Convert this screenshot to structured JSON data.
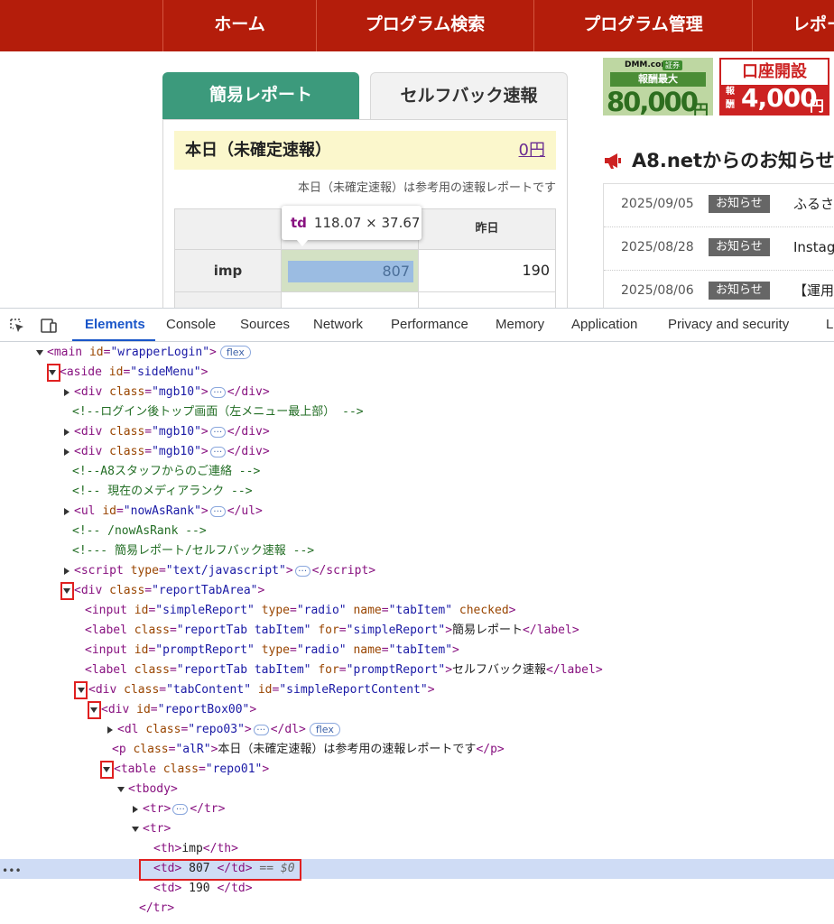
{
  "nav": {
    "items": [
      "ホーム",
      "プログラム検索",
      "プログラム管理",
      "レポート"
    ],
    "bg_color": "#b41d0b"
  },
  "report": {
    "tabs": [
      "簡易レポート",
      "セルフバック速報"
    ],
    "today_label": "本日（未確定速報）",
    "today_amount": "0円",
    "note": "本日（未確定速報）は参考用の速報レポートです",
    "col_yesterday": "昨日",
    "row_imp": "imp",
    "imp_today": "807",
    "imp_yesterday": "190",
    "accent_color": "#3c9a7c"
  },
  "tooltip": {
    "tag": "td",
    "size": "118.07 × 37.67"
  },
  "banners": {
    "dmm": {
      "logo": "DMM.com",
      "badge": "証券",
      "sub": "報酬最大",
      "amount": "80,000",
      "yen": "円"
    },
    "open": {
      "title": "口座開設",
      "reward": "報酬",
      "amount": "4,000",
      "yen": "円"
    }
  },
  "news": {
    "title": "A8.netからのお知らせ",
    "rows": [
      {
        "date": "2025/09/05",
        "badge": "お知らせ",
        "text": "ふるさ"
      },
      {
        "date": "2025/08/28",
        "badge": "お知らせ",
        "text": "Instag"
      },
      {
        "date": "2025/08/06",
        "badge": "お知らせ",
        "text": "【運用"
      }
    ]
  },
  "devtools": {
    "tabs": [
      "Elements",
      "Console",
      "Sources",
      "Network",
      "Performance",
      "Memory",
      "Application",
      "Privacy and security",
      "L"
    ],
    "active_tab": "Elements"
  },
  "dom": {
    "flex": "flex",
    "eq": "== $0",
    "comment_top": "<!--ログイン後トップ画面（左メニュー最上部） -->",
    "comment_staff": "<!--A8スタッフからのご連絡 -->",
    "comment_rank": "<!-- 現在のメディアランク -->",
    "comment_rank_end": "<!-- /nowAsRank -->",
    "comment_report": "<!--- 簡易レポート/セルフバック速報 -->",
    "label_simple": "簡易レポート",
    "label_self": "セルフバック速報",
    "p_text": "本日（未確定速報）は参考用の速報レポートです",
    "th_imp": "imp",
    "td_807": " 807 ",
    "td_190": " 190 "
  }
}
